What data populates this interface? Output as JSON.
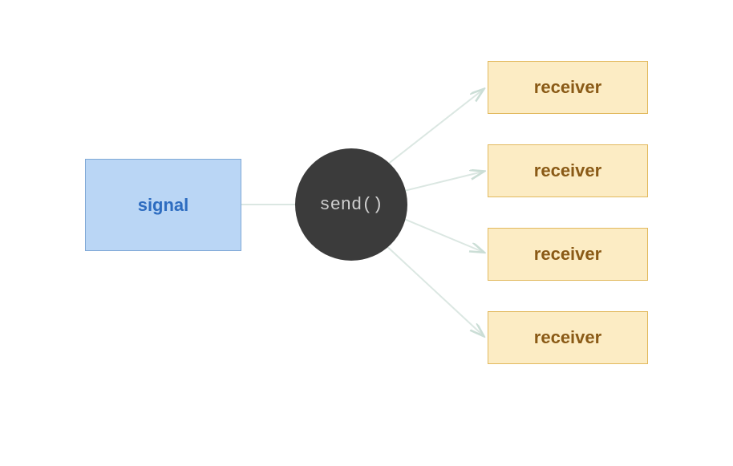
{
  "diagram": {
    "signal": {
      "label": "signal"
    },
    "send": {
      "label": "send()"
    },
    "receivers": [
      {
        "label": "receiver"
      },
      {
        "label": "receiver"
      },
      {
        "label": "receiver"
      },
      {
        "label": "receiver"
      }
    ]
  },
  "colors": {
    "signal_fill": "#bad6f5",
    "signal_border": "#7fa8d6",
    "signal_text": "#2d6cc0",
    "send_fill": "#3b3b3b",
    "send_text": "#cfcfcf",
    "receiver_fill": "#fcecc4",
    "receiver_border": "#e2b95e",
    "receiver_text": "#8a5a16",
    "connector": "#dbe7e2"
  }
}
